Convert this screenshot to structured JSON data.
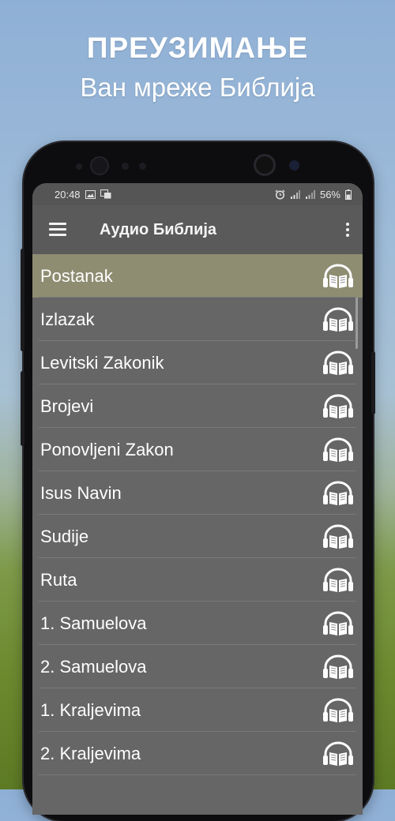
{
  "promo": {
    "title": "ПРЕУЗИМАЊЕ",
    "subtitle": "Ван мреже Библија"
  },
  "status_bar": {
    "time": "20:48",
    "battery": "56%"
  },
  "toolbar": {
    "title": "Аудио Библија"
  },
  "books": [
    {
      "name": "Postanak",
      "selected": true
    },
    {
      "name": "Izlazak",
      "selected": false
    },
    {
      "name": "Levitski Zakonik",
      "selected": false
    },
    {
      "name": "Brojevi",
      "selected": false
    },
    {
      "name": "Ponovljeni Zakon",
      "selected": false
    },
    {
      "name": "Isus Navin",
      "selected": false
    },
    {
      "name": "Sudije",
      "selected": false
    },
    {
      "name": "Ruta",
      "selected": false
    },
    {
      "name": "1. Samuelova",
      "selected": false
    },
    {
      "name": "2. Samuelova",
      "selected": false
    },
    {
      "name": "1. Kraljevima",
      "selected": false
    },
    {
      "name": "2. Kraljevima",
      "selected": false
    }
  ],
  "colors": {
    "list_background": "#666666",
    "selected_row": "#8e8d72",
    "toolbar": "#5a5a5a"
  }
}
